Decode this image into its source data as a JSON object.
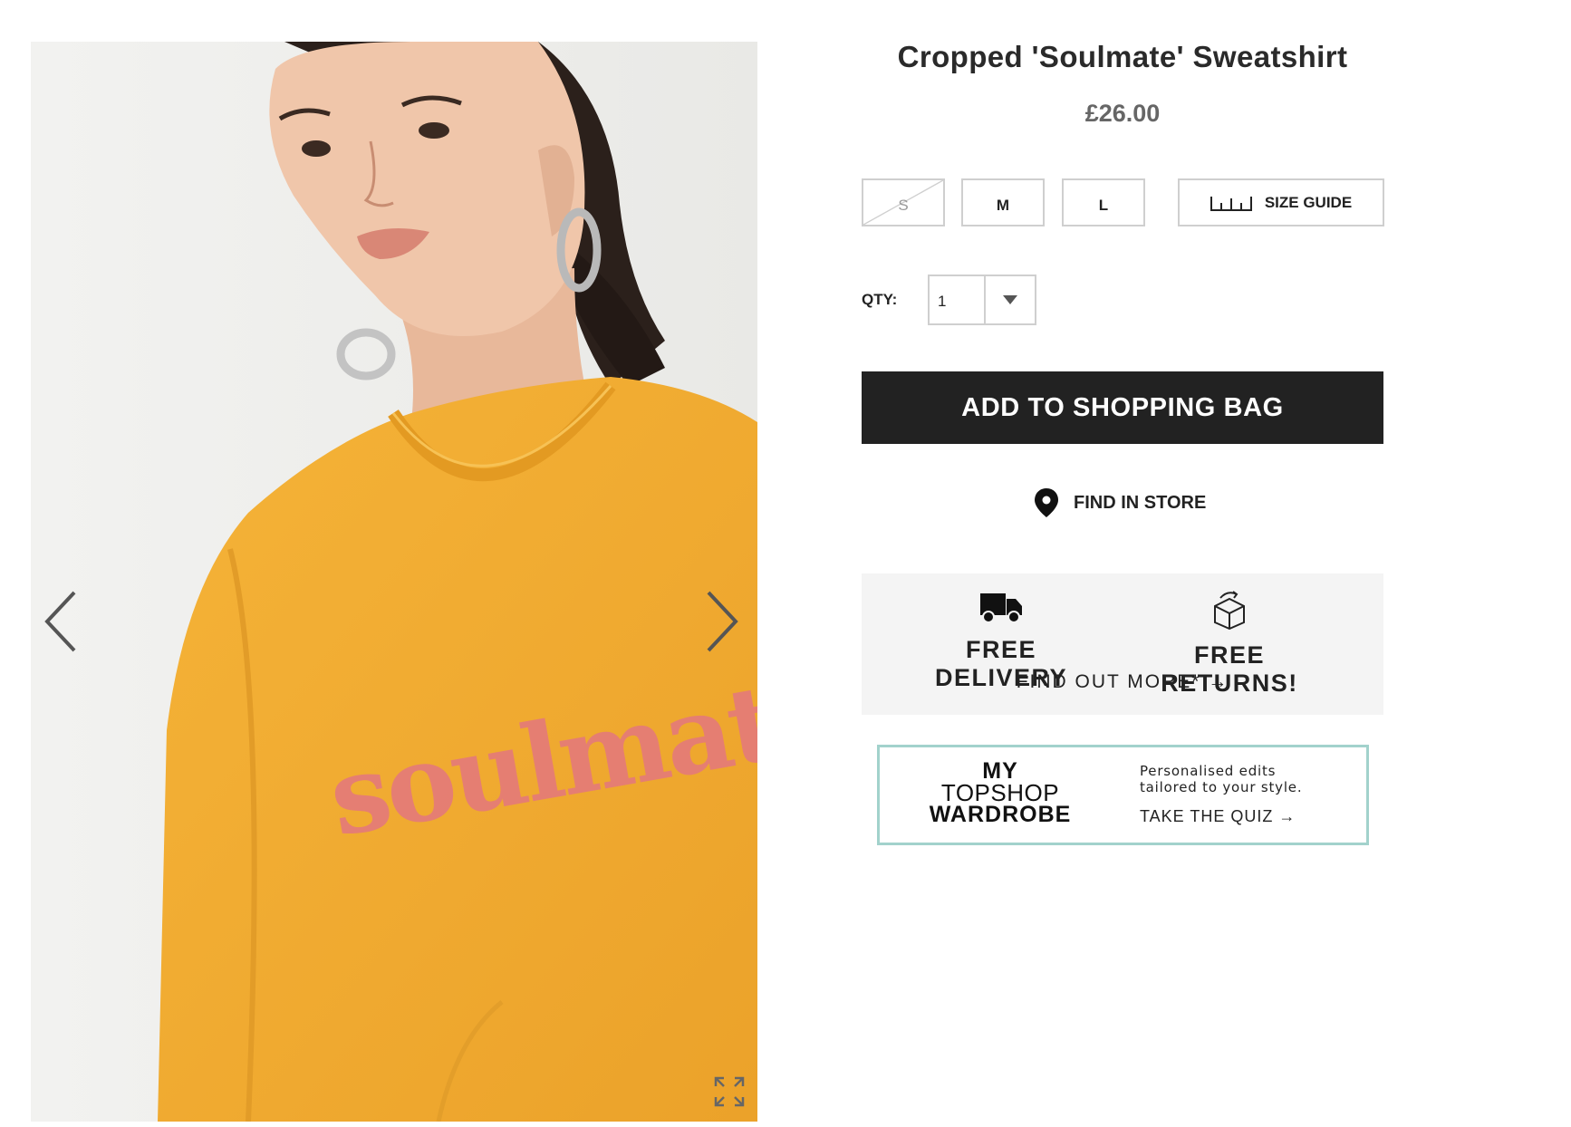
{
  "product": {
    "title": "Cropped 'Soulmate' Sweatshirt",
    "price": "£26.00",
    "print_text": "soulmate"
  },
  "sizes": [
    {
      "label": "S",
      "available": false
    },
    {
      "label": "M",
      "available": true
    },
    {
      "label": "L",
      "available": true
    }
  ],
  "size_guide_label": "SIZE GUIDE",
  "quantity": {
    "label": "QTY:",
    "value": "1"
  },
  "add_to_bag_label": "ADD TO SHOPPING BAG",
  "find_in_store_label": "FIND IN STORE",
  "promo": {
    "delivery_label": "FREE DELIVERY",
    "returns_label": "FREE RETURNS!",
    "find_out_more": "FIND OUT MORE* →"
  },
  "wardrobe": {
    "logo_line1": "MY",
    "logo_line2": "TOPSHOP",
    "logo_line3": "WARDROBE",
    "tagline_line1": "Personalised edits",
    "tagline_line2": "tailored to your style.",
    "cta": "TAKE THE QUIZ →"
  },
  "icons": {
    "prev": "chevron-left-icon",
    "next": "chevron-right-icon",
    "expand": "expand-icon",
    "ruler": "ruler-icon",
    "dropdown": "caret-down-icon",
    "location": "map-pin-icon",
    "truck": "truck-icon",
    "box": "box-icon"
  },
  "colors": {
    "button_bg": "#222222",
    "promo_bg": "#f4f4f4",
    "wardrobe_border": "#a2d2cc",
    "sweatshirt": "#f1aa30",
    "print": "#e57b78"
  }
}
